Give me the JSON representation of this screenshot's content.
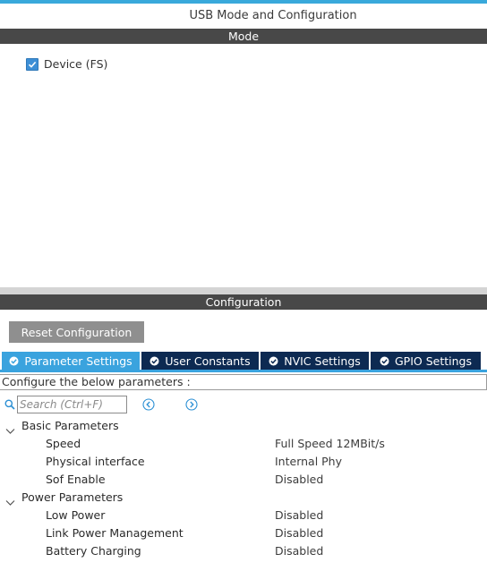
{
  "window": {
    "title": "USB Mode and Configuration"
  },
  "mode": {
    "header": "Mode",
    "device_checkbox": {
      "label": "Device (FS)",
      "checked": true
    }
  },
  "configuration": {
    "header": "Configuration",
    "reset_label": "Reset Configuration",
    "tabs": [
      {
        "label": "Parameter Settings",
        "active": true
      },
      {
        "label": "User Constants",
        "active": false
      },
      {
        "label": "NVIC Settings",
        "active": false
      },
      {
        "label": "GPIO Settings",
        "active": false
      }
    ],
    "configure_text": "Configure the below parameters :",
    "search_placeholder": "Search (Ctrl+F)",
    "groups": [
      {
        "name": "Basic Parameters",
        "params": [
          {
            "name": "Speed",
            "value": "Full Speed 12MBit/s"
          },
          {
            "name": "Physical interface",
            "value": "Internal Phy"
          },
          {
            "name": "Sof Enable",
            "value": "Disabled"
          }
        ]
      },
      {
        "name": "Power Parameters",
        "params": [
          {
            "name": "Low Power",
            "value": "Disabled"
          },
          {
            "name": "Link Power Management",
            "value": "Disabled"
          },
          {
            "name": "Battery Charging",
            "value": "Disabled"
          }
        ]
      }
    ]
  },
  "colors": {
    "accent": "#3aa3de",
    "tab_inactive": "#0d2a52",
    "section_bar": "#484848",
    "button_gray": "#8f8f8f"
  },
  "icons": {
    "checkbox": "check-icon",
    "tab": "check-circle-icon",
    "search": "search-icon",
    "prev": "chevron-left-circle-icon",
    "next": "chevron-right-circle-icon",
    "expand": "chevron-down-icon"
  }
}
